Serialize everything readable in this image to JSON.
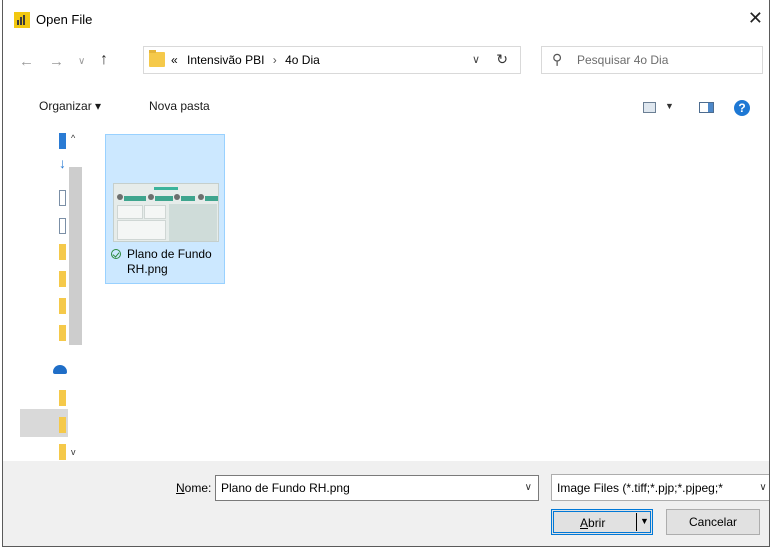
{
  "window": {
    "title": "Open File",
    "close_glyph": "✕"
  },
  "nav": {
    "back_glyph": "←",
    "forward_glyph": "→",
    "recent_glyph": "∨",
    "up_glyph": "↑",
    "breadcrumb_overflow": "«",
    "breadcrumb": [
      "Intensivão PBI",
      "4o Dia"
    ],
    "breadcrumb_sep": "›",
    "refresh_glyph": "↻",
    "dropdown_glyph": "∨"
  },
  "search": {
    "placeholder": "Pesquisar 4o Dia",
    "icon_glyph": "⚲"
  },
  "toolbar": {
    "organize_label": "Organizar ▾",
    "new_folder_label": "Nova pasta",
    "view_caret": "▼",
    "help_glyph": "?"
  },
  "navpane": {
    "scroll_up": "^",
    "scroll_down": "v",
    "items": [
      "blue-folder",
      "download",
      "document",
      "document",
      "folder",
      "folder",
      "folder",
      "folder",
      "onedrive",
      "folder",
      "folder",
      "folder"
    ]
  },
  "files": [
    {
      "name": "Plano de Fundo RH.png",
      "synced": true
    }
  ],
  "bottom": {
    "name_label_underlined": "N",
    "name_label_rest": "ome:",
    "name_value": "Plano de Fundo RH.png",
    "name_caret": "∨",
    "filetype_value": "Image Files (*.tiff;*.pjp;*.pjpeg;*",
    "filetype_caret": "∨",
    "open_label_underlined": "A",
    "open_label_rest": "brir",
    "open_caret": "▼",
    "cancel_label": "Cancelar"
  },
  "colors": {
    "selection_fill": "#cce8ff",
    "selection_border": "#99d1ff",
    "accent": "#0078d7",
    "folder": "#f5c94a",
    "powerbi_icon": "#f2c811"
  }
}
